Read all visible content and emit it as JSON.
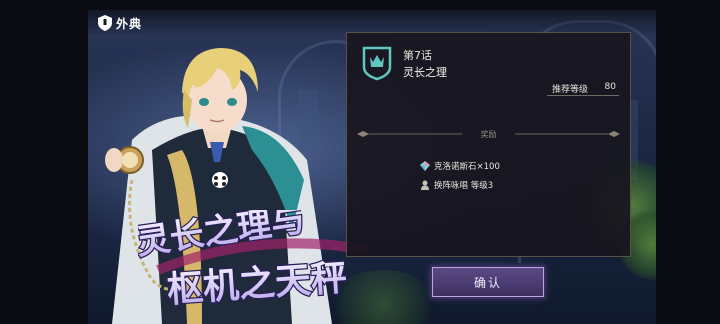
{
  "header": {
    "title": "外典",
    "icon": "shield-icon"
  },
  "artwork": {
    "logo_line1": "灵长之理与",
    "logo_line2": "枢机之天秤"
  },
  "chapter": {
    "number": "第7话",
    "name": "灵长之理",
    "icon": "crown-shield-icon",
    "recommended_label": "推荐等级",
    "recommended_value": "80"
  },
  "rewards": {
    "label": "奖励",
    "items": [
      {
        "icon": "crystal-icon",
        "text": "克洛诺斯石×100"
      },
      {
        "icon": "character-icon",
        "text": "换阵咏唱 等级3"
      }
    ]
  },
  "actions": {
    "confirm_label": "确认"
  },
  "colors": {
    "panel_bg": "#18161e",
    "accent_teal": "#5fc7c0",
    "button_purple": "#4a3a72"
  }
}
